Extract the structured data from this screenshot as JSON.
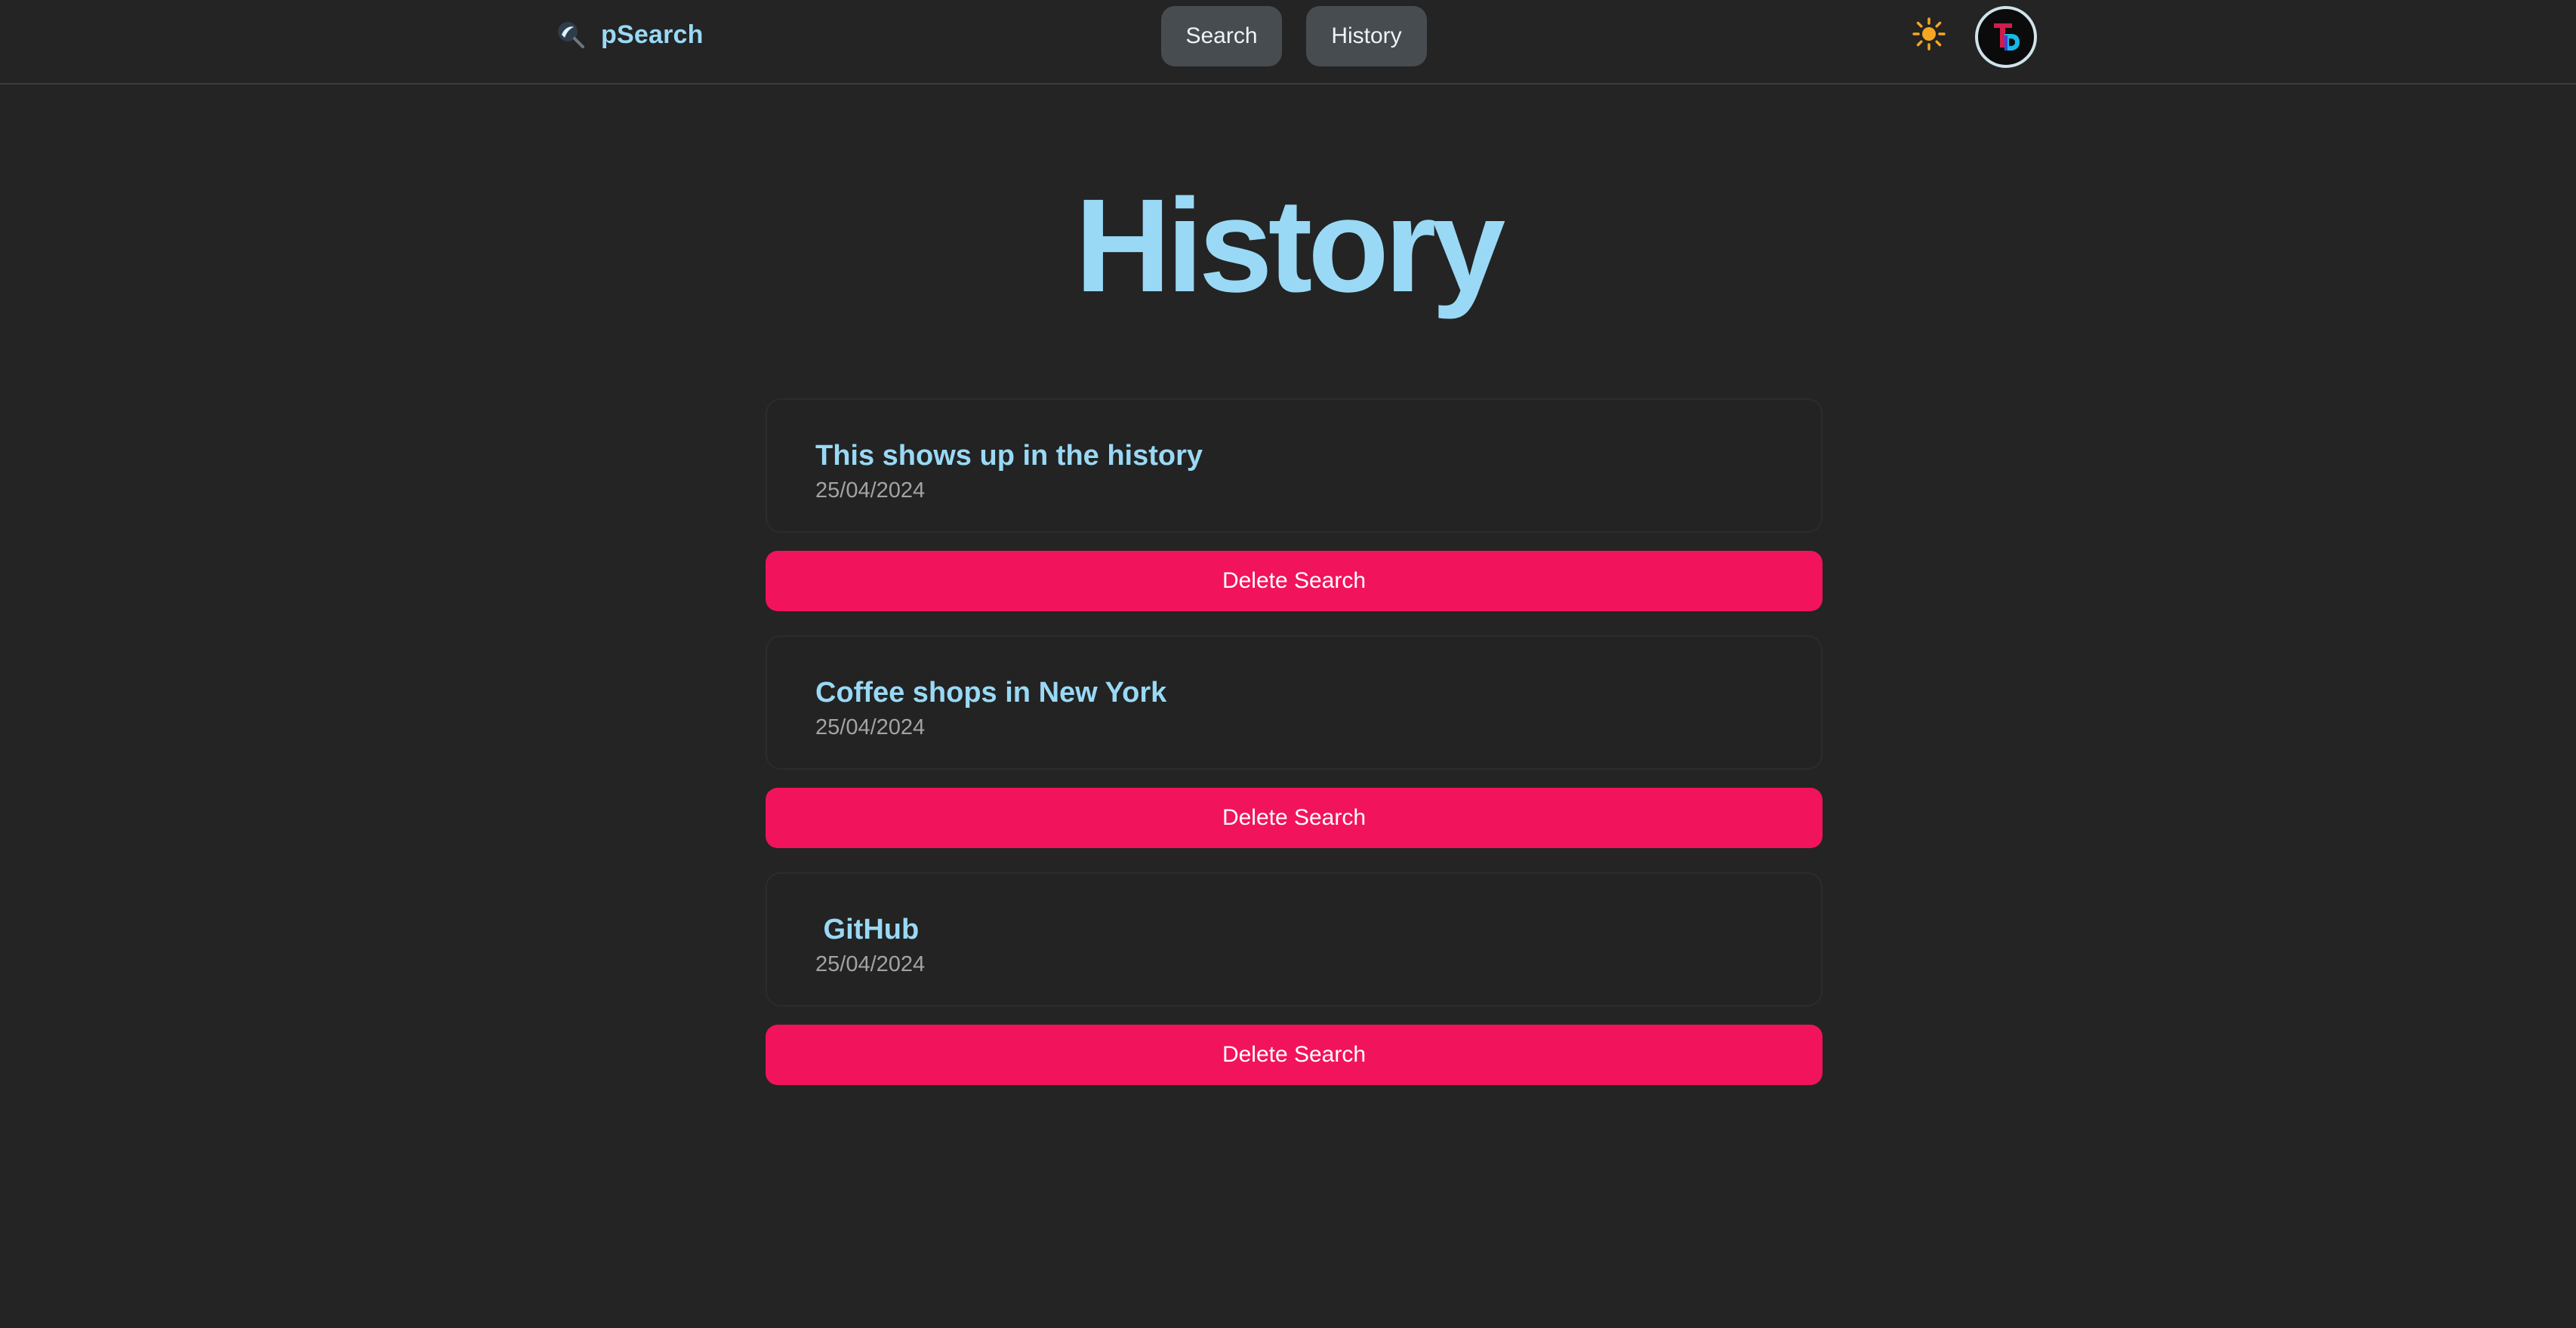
{
  "header": {
    "brand_name": "pSearch",
    "nav": {
      "search_label": "Search",
      "history_label": "History"
    },
    "theme_icon": "sun-icon",
    "avatar_icon": "user-avatar"
  },
  "main": {
    "title": "History",
    "entries": [
      {
        "query": "This shows up in the history",
        "date": "25/04/2024",
        "delete_label": "Delete Search"
      },
      {
        "query": "Coffee shops in New York",
        "date": "25/04/2024",
        "delete_label": "Delete Search"
      },
      {
        "query": " GitHub",
        "date": "25/04/2024",
        "delete_label": "Delete Search"
      }
    ]
  },
  "colors": {
    "background": "#242424",
    "accent": "#99d9f5",
    "danger": "#f2135d",
    "nav_button": "#474c50",
    "sun": "#f5a623"
  }
}
